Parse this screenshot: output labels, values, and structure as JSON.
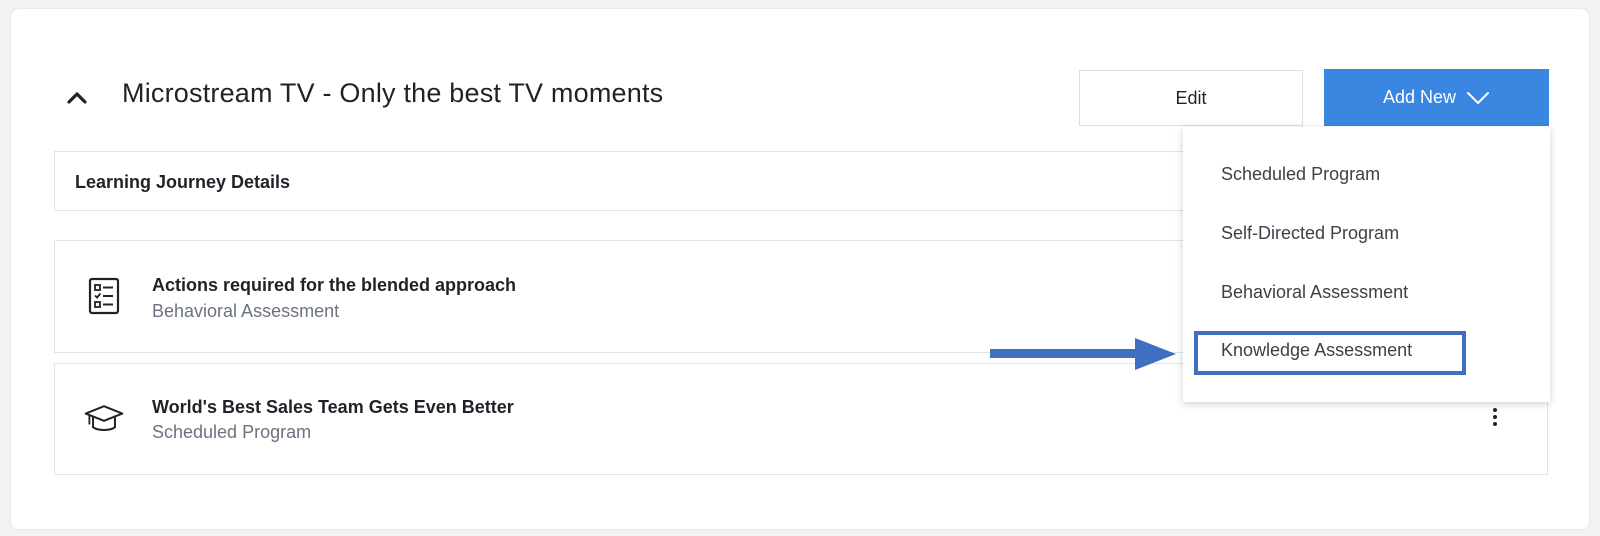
{
  "header": {
    "title": "Microstream TV - Only the best TV moments",
    "collapse_icon": "chevron-up-icon",
    "edit_label": "Edit",
    "add_new_label": "Add New",
    "add_new_icon": "chevron-down-icon"
  },
  "details": {
    "label": "Learning Journey Details"
  },
  "items": [
    {
      "title": "Actions required for the blended approach",
      "subtitle": "Behavioral Assessment",
      "icon": "checklist-icon"
    },
    {
      "title": "World's Best Sales Team Gets Even Better",
      "subtitle": "Scheduled Program",
      "icon": "graduation-cap-icon"
    }
  ],
  "menu": {
    "items": [
      "Scheduled Program",
      "Self-Directed Program",
      "Behavioral Assessment",
      "Knowledge Assessment"
    ],
    "highlighted": "Knowledge Assessment"
  },
  "colors": {
    "accent": "#3a86e0",
    "annotation": "#3e6fc0"
  }
}
